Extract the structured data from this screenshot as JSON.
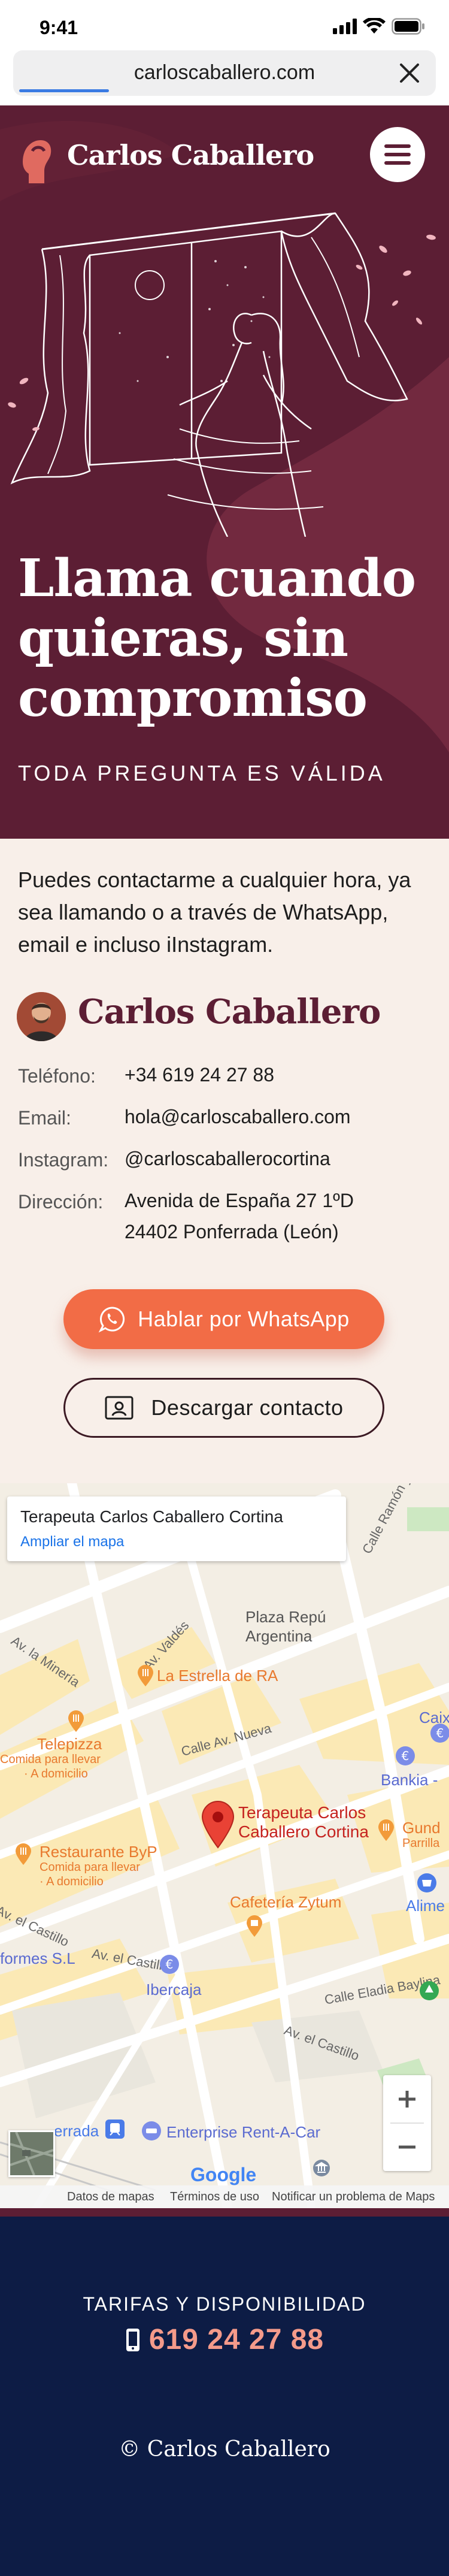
{
  "status_bar": {
    "time": "9:41"
  },
  "browser": {
    "url": "carloscaballero.com"
  },
  "header": {
    "logo_text": "Carlos Caballero"
  },
  "hero": {
    "title_lines": [
      "Llama cuando",
      "quieras, sin",
      "compromiso"
    ],
    "subtitle": "TODA PREGUNTA ES VÁLIDA"
  },
  "contact": {
    "intro": "Puedes contactarme a cualquier hora, ya sea llamando o a través de WhatsApp, email e incluso iInstagram.",
    "name": "Carlos Caballero",
    "rows": [
      {
        "label": "Teléfono:",
        "value": "+34 619 24 27 88"
      },
      {
        "label": "Email:",
        "value": "hola@carloscaballero.com"
      },
      {
        "label": "Instagram:",
        "value": "@carloscaballerocortina"
      },
      {
        "label": "Dirección:",
        "value": "Avenida de España 27 1ºD",
        "value2": "24402 Ponferrada (León)"
      }
    ],
    "whatsapp_button": "Hablar por WhatsApp",
    "vcard_button": "Descargar contacto"
  },
  "map": {
    "card_title": "Terapeuta Carlos Caballero Cortina",
    "card_link": "Ampliar el mapa",
    "pin_label_1": "Terapeuta Carlos",
    "pin_label_2": "Caballero Cortina",
    "places": {
      "plaza": "Plaza Repú",
      "plaza2": "Argentina",
      "estrella": "La Estrella de RA",
      "telepizza": "Telepizza",
      "telepizza_sub1": "Comida para llevar",
      "telepizza_sub2": "· A domicilio",
      "restaurante": "Restaurante ByP",
      "restaurante_sub1": "Comida para llevar",
      "restaurante_sub2": "· A domicilio",
      "bankia": "Bankia -",
      "caixabank": "CaixaBa",
      "cafeteria": "Cafetería Zytum",
      "ibercaja": "Ibercaja",
      "alime": "Alime",
      "gund": "Gund",
      "gund_sub": "Parrilla",
      "formes": "formes S.L",
      "enterprise": "Enterprise Rent-A-Car",
      "errada": "errada"
    },
    "streets": {
      "ramon": "Calle Ramón y Cajal",
      "valdes": "Av. Valdés",
      "mineria": "Av. la Minería",
      "nueva": "Calle Av. Nueva",
      "castillo1": "Av. el Castillo",
      "castillo2": "Av. el Castillo",
      "castillo3": "Av. el Castillo",
      "eladia": "Calle Eladia Baylina"
    },
    "footer_links": [
      "Datos de mapas",
      "Términos de uso",
      "Notificar un problema de Maps"
    ],
    "google": "Google"
  },
  "footer": {
    "rates_label": "TARIFAS Y DISPONIBILIDAD",
    "phone": "619 24 27 88",
    "copyright": "© Carlos Caballero"
  },
  "colors": {
    "hero_bg": "#5c1e34",
    "cream": "#f8efe9",
    "accent": "#f26c46",
    "footer_bg": "#0d1c45",
    "footer_phone": "#f49a8a"
  }
}
